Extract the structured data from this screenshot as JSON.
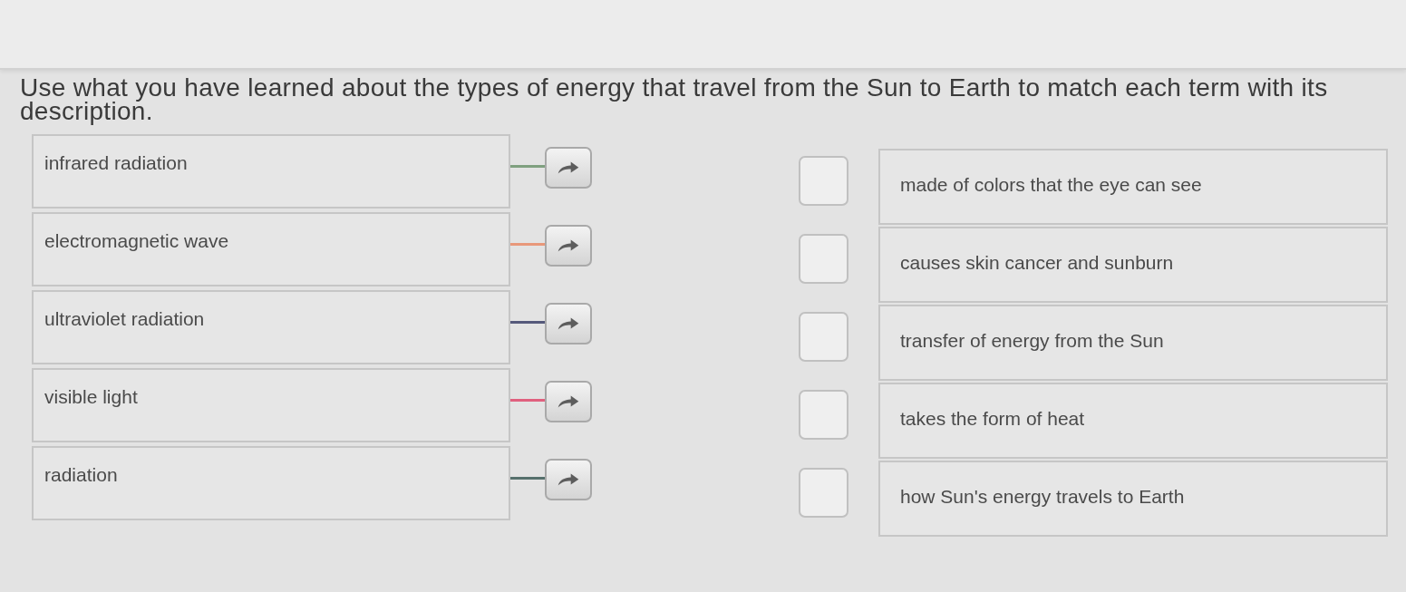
{
  "prompt": "Use what you have learned about the types of energy that travel from the Sun to Earth to match each term with its description.",
  "terms": [
    {
      "text": "infrared radiation",
      "color": "#7fa07f"
    },
    {
      "text": "electromagnetic wave",
      "color": "#e8987a"
    },
    {
      "text": "ultraviolet radiation",
      "color": "#55597a"
    },
    {
      "text": "visible light",
      "color": "#e0607e"
    },
    {
      "text": "radiation",
      "color": "#56706c"
    }
  ],
  "descriptions": [
    {
      "text": "made of colors that the eye can see"
    },
    {
      "text": "causes skin cancer and sunburn"
    },
    {
      "text": "transfer of energy from the Sun"
    },
    {
      "text": "takes the form of heat"
    },
    {
      "text": "how Sun's energy travels to Earth"
    }
  ]
}
